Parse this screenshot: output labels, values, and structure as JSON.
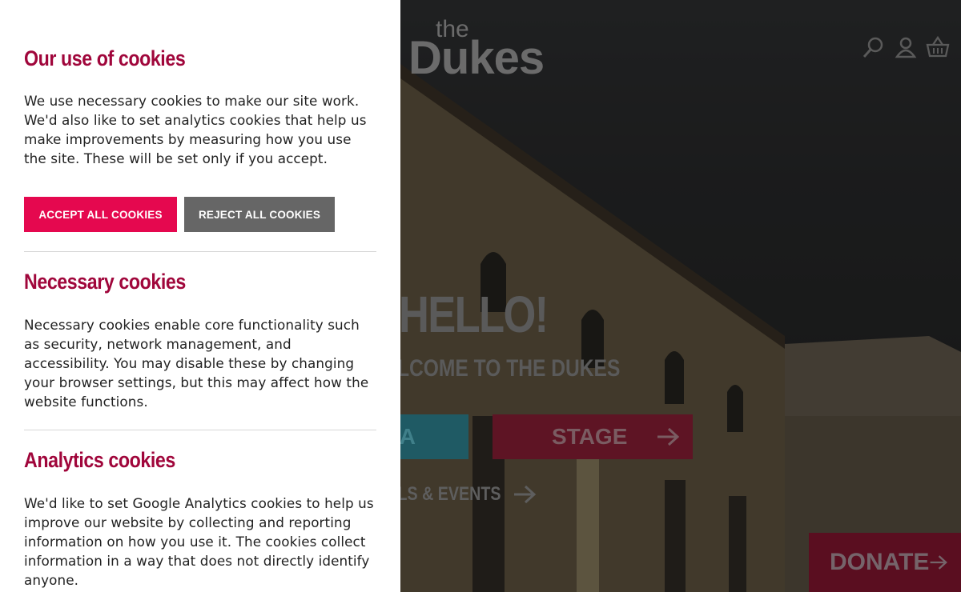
{
  "cookie_panel": {
    "title": "Our use of cookies",
    "intro": "We use necessary cookies to make our site work. We'd also like to set analytics cookies that help us make improvements by measuring how you use the site. These will be set only if you accept.",
    "accept_label": "ACCEPT ALL COOKIES",
    "reject_label": "REJECT ALL COOKIES",
    "necessary": {
      "title": "Necessary cookies",
      "text": "Necessary cookies enable core functionality such as security, network management, and accessibility. You may disable these by changing your browser settings, but this may affect how the website functions."
    },
    "analytics": {
      "title": "Analytics cookies",
      "text": "We'd like to set Google Analytics cookies to help us improve our website by collecting and reporting information on how you use it. The cookies collect information in a way that does not directly identify anyone."
    }
  },
  "site": {
    "logo_the": "the",
    "logo_main": "Dukes",
    "hero_title": "HELLO!",
    "hero_subtitle": "LCOME TO THE DUKES",
    "cinema_label": "A",
    "stage_label": "STAGE",
    "festivals_label": "STIVALS & EVENTS",
    "donate_label": "DONATE",
    "icons": [
      "search-icon",
      "account-icon",
      "basket-icon",
      "arrow-right-icon"
    ]
  },
  "colors": {
    "accent": "#e5084f",
    "heading": "#a0063b",
    "reject": "#666666"
  }
}
